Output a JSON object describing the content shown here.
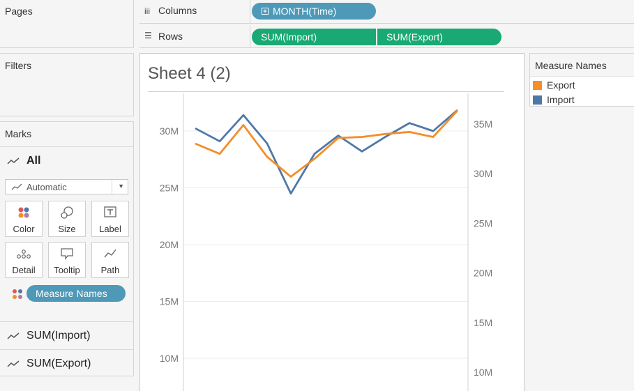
{
  "panels": {
    "pages_title": "Pages",
    "filters_title": "Filters",
    "marks_title": "Marks"
  },
  "marks": {
    "all_label": "All",
    "mark_type": "Automatic",
    "buttons": {
      "color": "Color",
      "size": "Size",
      "label": "Label",
      "detail": "Detail",
      "tooltip": "Tooltip",
      "path": "Path"
    },
    "color_pill": "Measure Names",
    "measure_cards": [
      "SUM(Import)",
      "SUM(Export)"
    ]
  },
  "shelves": {
    "columns_label": "Columns",
    "columns_pill": "MONTH(Time)",
    "rows_label": "Rows",
    "rows_pills": [
      "SUM(Import)",
      "SUM(Export)"
    ]
  },
  "sheet": {
    "title": "Sheet 4 (2)"
  },
  "legend": {
    "title": "Measure Names",
    "items": [
      {
        "name": "Export",
        "color": "#f28e2b"
      },
      {
        "name": "Import",
        "color": "#4e79a7"
      }
    ]
  },
  "colors": {
    "pill_blue": "#4e99b8",
    "pill_green": "#19a974",
    "export": "#f28e2b",
    "import": "#4e79a7"
  },
  "chart_data": {
    "type": "line",
    "x": [
      1,
      2,
      3,
      4,
      5,
      6,
      7,
      8,
      9,
      10,
      11,
      12
    ],
    "series": [
      {
        "name": "Import",
        "axis": "left",
        "color": "#4e79a7",
        "values": [
          30.2,
          29.1,
          31.4,
          28.9,
          24.5,
          28.0,
          29.6,
          28.2,
          29.5,
          30.7,
          30.0,
          31.8
        ]
      },
      {
        "name": "Export",
        "axis": "right",
        "color": "#f28e2b",
        "values": [
          33.0,
          32.0,
          34.9,
          31.7,
          29.7,
          31.5,
          33.6,
          33.7,
          34.0,
          34.2,
          33.7,
          36.3
        ]
      }
    ],
    "left_axis": {
      "ticks": [
        10,
        15,
        20,
        25,
        30
      ],
      "tick_labels": [
        "10M",
        "15M",
        "20M",
        "25M",
        "30M"
      ]
    },
    "right_axis": {
      "ticks": [
        10,
        15,
        20,
        25,
        30,
        35
      ],
      "tick_labels": [
        "10M",
        "15M",
        "20M",
        "25M",
        "30M",
        "35M"
      ]
    },
    "grid": true
  }
}
